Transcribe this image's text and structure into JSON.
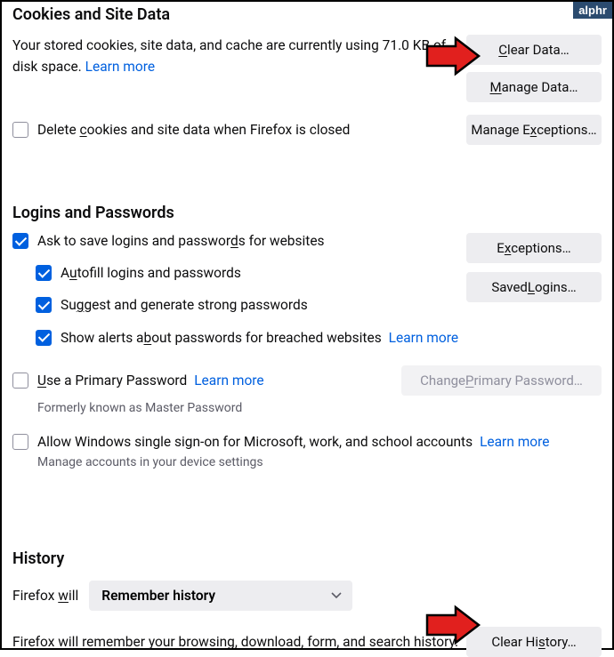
{
  "badge": "alphr",
  "cookies": {
    "title": "Cookies and Site Data",
    "desc_pre": "Your stored cookies, site data, and cache are currently using ",
    "size": "71.0 KB",
    "desc_post": " of disk space.   ",
    "learn_more": "Learn more",
    "clear_data_btn": "Clear Data…",
    "manage_data_btn": "Manage Data…",
    "manage_exceptions_btn": "Manage Exceptions…",
    "delete_on_close": "Delete cookies and site data when Firefox is closed"
  },
  "logins": {
    "title": "Logins and Passwords",
    "ask_save": "Ask to save logins and passwords for websites",
    "autofill": "Autofill logins and passwords",
    "suggest": "Suggest and generate strong passwords",
    "alerts": "Show alerts about passwords for breached websites",
    "alerts_learn_more": "Learn more",
    "exceptions_btn": "Exceptions…",
    "saved_btn": "Saved Logins…",
    "primary_pw": "Use a Primary Password",
    "primary_learn_more": "Learn more",
    "primary_helper": "Formerly known as Master Password",
    "change_primary_btn": "Change Primary Password…",
    "win_sso": "Allow Windows single sign-on for Microsoft, work, and school accounts",
    "win_sso_learn_more": "Learn more",
    "win_sso_helper": "Manage accounts in your device settings"
  },
  "history": {
    "title": "History",
    "will_label_pre": "Firefox ",
    "will_label_u": "will",
    "dropdown_value": "Remember history",
    "desc": "Firefox will remember your browsing, download, form, and search history.",
    "clear_btn": "Clear History…"
  }
}
